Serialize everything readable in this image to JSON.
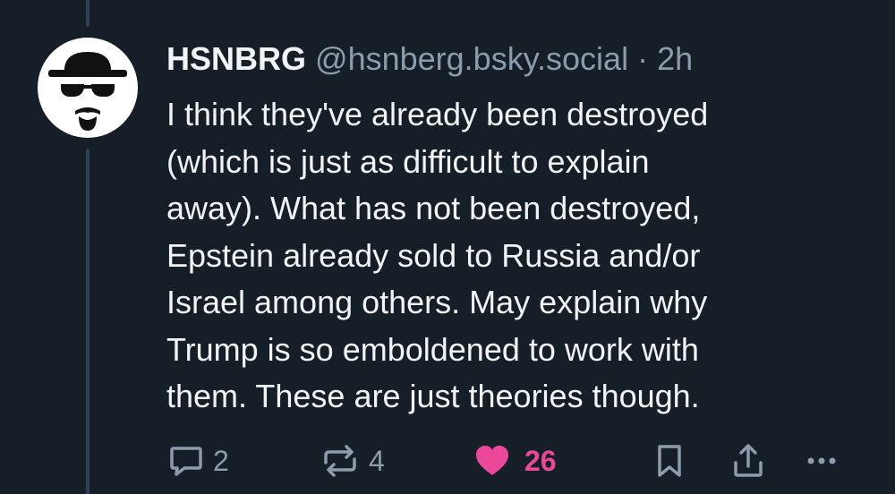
{
  "post": {
    "author": {
      "display_name": "HSNBRG",
      "handle": "@hsnberg.bsky.social",
      "avatar_icon": "fedora-sunglasses-avatar"
    },
    "separator": "·",
    "timestamp": "2h",
    "text_lines": [
      "I think they've already been destroyed",
      "(which is just as difficult to explain",
      "away). What has not been destroyed,",
      "Epstein already sold to Russia and/or",
      "Israel among others. May explain why",
      "Trump is so emboldened to work with",
      "them. These are just theories though."
    ],
    "actions": {
      "reply": {
        "icon": "speech-bubble-icon",
        "count": "2"
      },
      "repost": {
        "icon": "repost-icon",
        "count": "4"
      },
      "like": {
        "icon": "heart-icon",
        "count": "26",
        "liked": true,
        "color": "#ec4899"
      },
      "bookmark": {
        "icon": "bookmark-icon"
      },
      "share": {
        "icon": "share-icon"
      },
      "more": {
        "icon": "more-options-icon"
      }
    }
  },
  "theme": {
    "background": "#161e27",
    "text": "#f1f3f5",
    "muted": "#8c9cad",
    "thread_line": "#2e4052"
  }
}
